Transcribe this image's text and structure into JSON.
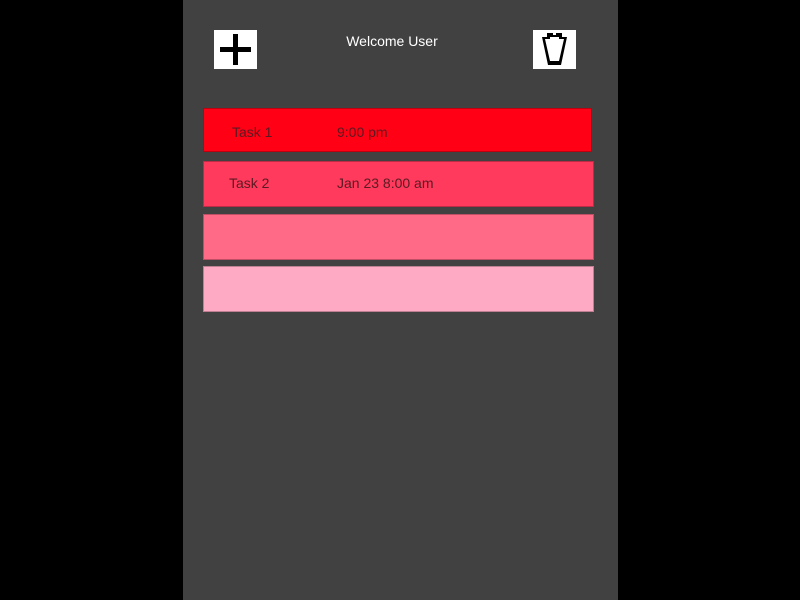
{
  "header": {
    "title": "Welcome User",
    "add_icon": "plus-icon",
    "trash_icon": "trash-icon"
  },
  "tasks": [
    {
      "name": "Task 1",
      "time": "9:00 pm",
      "color": "#ff0015"
    },
    {
      "name": "Task 2",
      "time": "Jan 23 8:00 am",
      "color": "#ff3a5c"
    },
    {
      "name": "",
      "time": "",
      "color": "#ff6a86"
    },
    {
      "name": "",
      "time": "",
      "color": "#ffaac4"
    }
  ],
  "theme": {
    "background": "#000000",
    "panel": "#414141",
    "button_bg": "#ffffff"
  }
}
